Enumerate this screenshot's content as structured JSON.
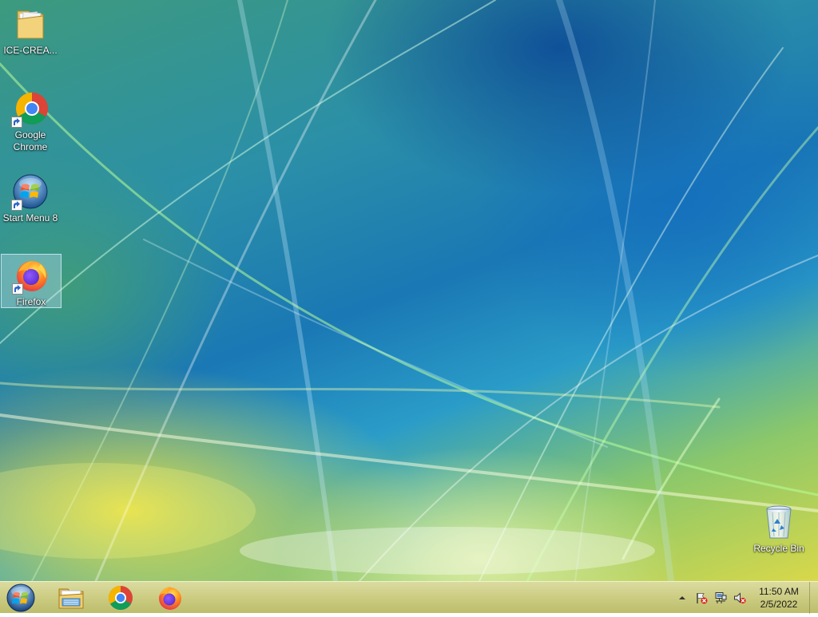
{
  "desktop": {
    "icons": [
      {
        "label": "ICE-CREA...",
        "icon": "folder-icon",
        "selected": false
      },
      {
        "label": "Google Chrome",
        "icon": "chrome-icon",
        "selected": false
      },
      {
        "label": "Start Menu 8",
        "icon": "windows-orb-icon",
        "selected": false
      },
      {
        "label": "Firefox",
        "icon": "firefox-icon",
        "selected": true
      },
      {
        "label": "Recycle Bin",
        "icon": "recycle-bin-icon",
        "selected": false
      }
    ]
  },
  "taskbar": {
    "start_button": "windows-orb-icon",
    "pinned": [
      {
        "name": "File Explorer",
        "icon": "file-explorer-icon"
      },
      {
        "name": "Google Chrome",
        "icon": "chrome-icon"
      },
      {
        "name": "Firefox",
        "icon": "firefox-icon"
      }
    ],
    "tray": {
      "icons": [
        "chevron-up-icon",
        "action-center-flag-icon",
        "network-icon",
        "volume-muted-icon"
      ],
      "time": "11:50 AM",
      "date": "2/5/2022"
    }
  },
  "colors": {
    "accent": "#1a78b4",
    "taskbar": "#c8c878"
  }
}
